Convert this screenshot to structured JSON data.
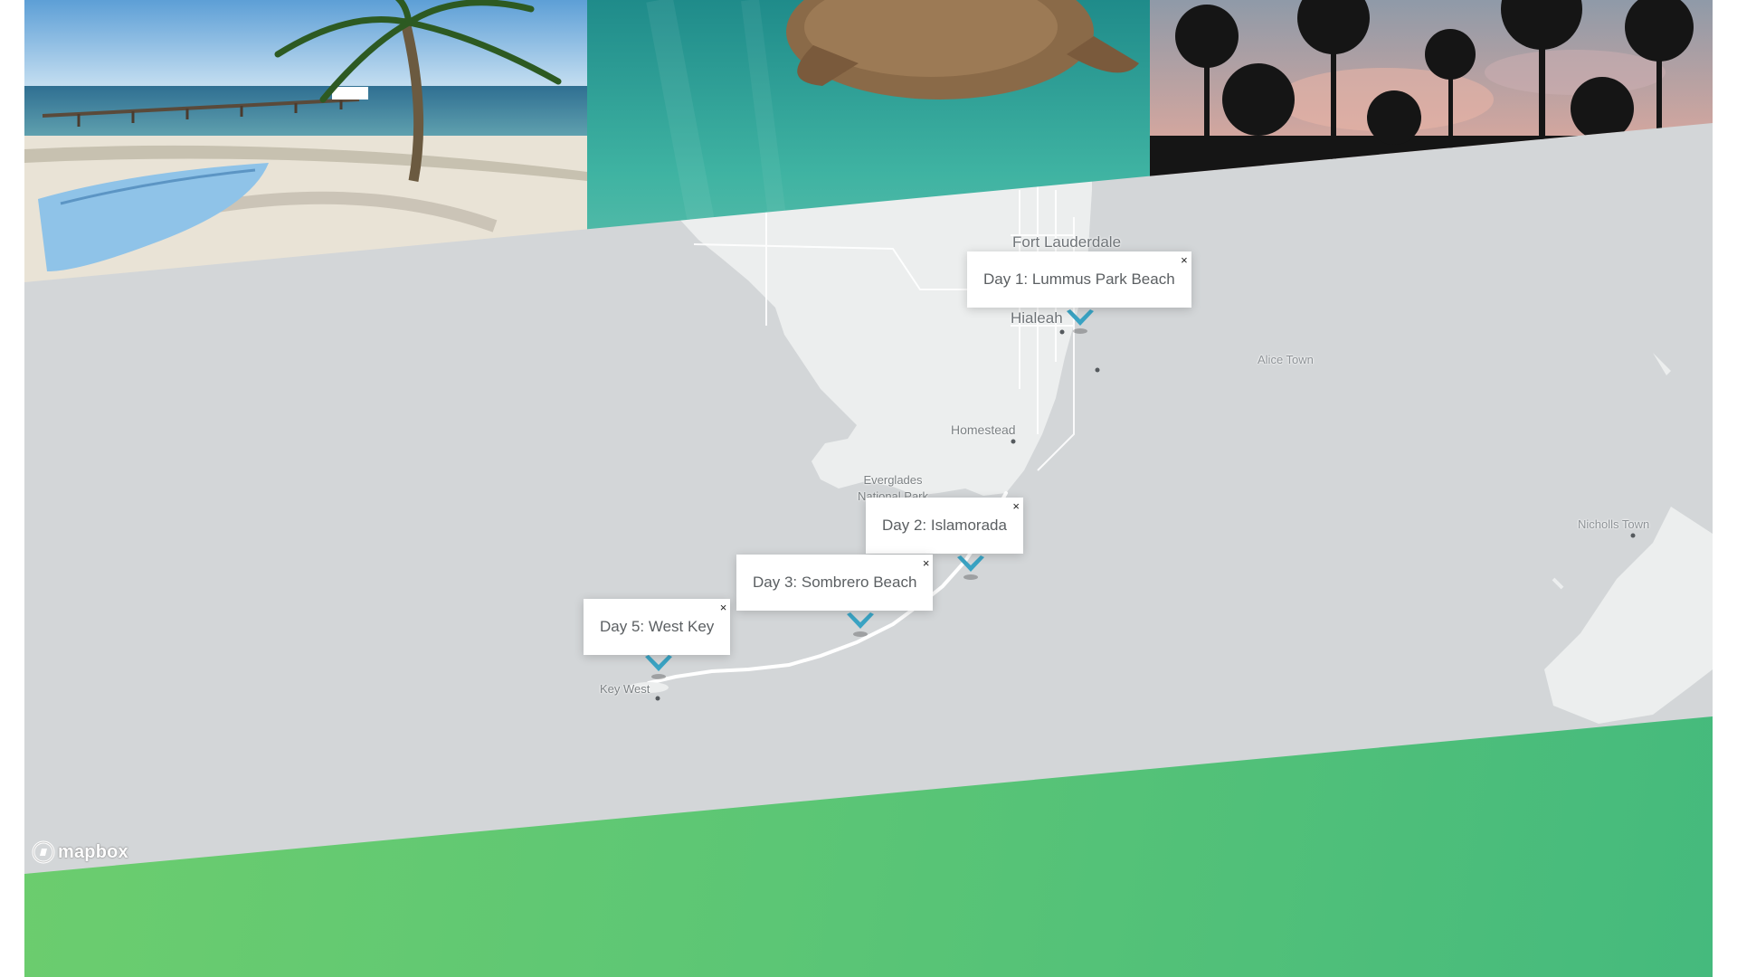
{
  "gallery": {
    "photos": [
      {
        "subject": "beach with palm tree, pier and blue canoe"
      },
      {
        "subject": "sea turtle swimming underwater"
      },
      {
        "subject": "palm tree silhouettes against pink sunset clouds"
      }
    ]
  },
  "map": {
    "labels": {
      "fort_lauderdale": "Fort Lauderdale",
      "hialeah": "Hialeah",
      "homestead": "Homestead",
      "everglades": "Everglades National Park",
      "key_west": "Key West",
      "alice_town": "Alice Town",
      "nicholls_town": "Nicholls Town"
    },
    "popups": [
      {
        "label": "Day 1: Lummus Park Beach",
        "close": "×"
      },
      {
        "label": "Day 2: Islamorada",
        "close": "×"
      },
      {
        "label": "Day 3: Sombrero Beach",
        "close": "×"
      },
      {
        "label": "Day 5: West Key",
        "close": "×"
      }
    ],
    "attribution": "mapbox"
  },
  "colors": {
    "map_water": "#d3d6d8",
    "map_land": "#eceeee",
    "marker": "#3aa3c3",
    "green_start": "#6ccd6e",
    "green_end": "#45ba7d"
  },
  "icons": {
    "marker": "chevron-pin-icon",
    "close": "close-icon",
    "logo": "mapbox-logo-icon"
  }
}
